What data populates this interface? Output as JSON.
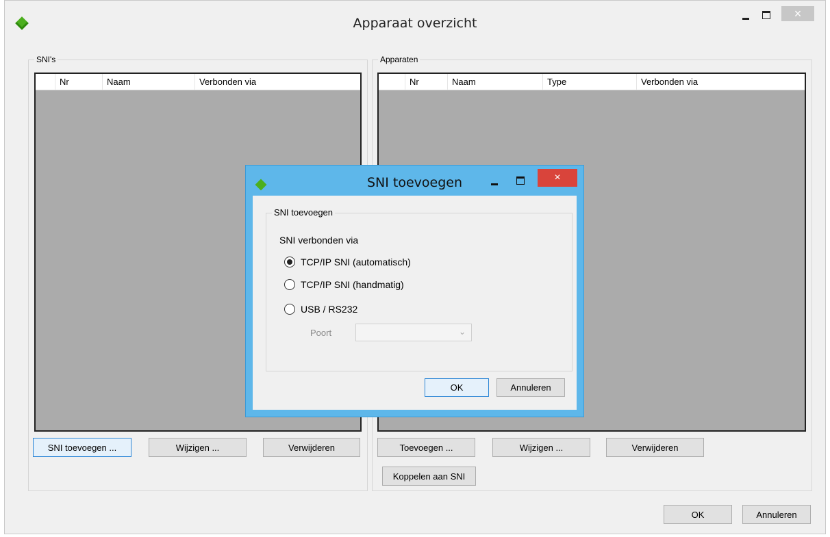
{
  "window": {
    "title": "Apparaat overzicht",
    "close_glyph": "×"
  },
  "snis": {
    "group_label": "SNI's",
    "columns": [
      "Nr",
      "Naam",
      "Verbonden via"
    ],
    "buttons": {
      "add": "SNI toevoegen ...",
      "edit": "Wijzigen ...",
      "remove": "Verwijderen"
    }
  },
  "devices": {
    "group_label": "Apparaten",
    "columns": [
      "Nr",
      "Naam",
      "Type",
      "Verbonden via"
    ],
    "buttons": {
      "add": "Toevoegen ...",
      "edit": "Wijzigen ...",
      "remove": "Verwijderen",
      "link": "Koppelen aan SNI"
    }
  },
  "footer": {
    "ok": "OK",
    "cancel": "Annuleren"
  },
  "dialog": {
    "title": "SNI toevoegen",
    "close_glyph": "×",
    "group_label": "SNI toevoegen",
    "prompt": "SNI verbonden via",
    "options": [
      {
        "label": "TCP/IP SNI (automatisch)",
        "selected": true
      },
      {
        "label": "TCP/IP SNI (handmatig)",
        "selected": false
      },
      {
        "label": "USB / RS232",
        "selected": false
      }
    ],
    "port_label": "Poort",
    "port_value": "",
    "ok": "OK",
    "cancel": "Annuleren"
  },
  "colors": {
    "dialog_frame": "#5eb7ea",
    "close_red": "#d9443b",
    "list_bg": "#ababab",
    "app_icon": "#4caf1e"
  }
}
